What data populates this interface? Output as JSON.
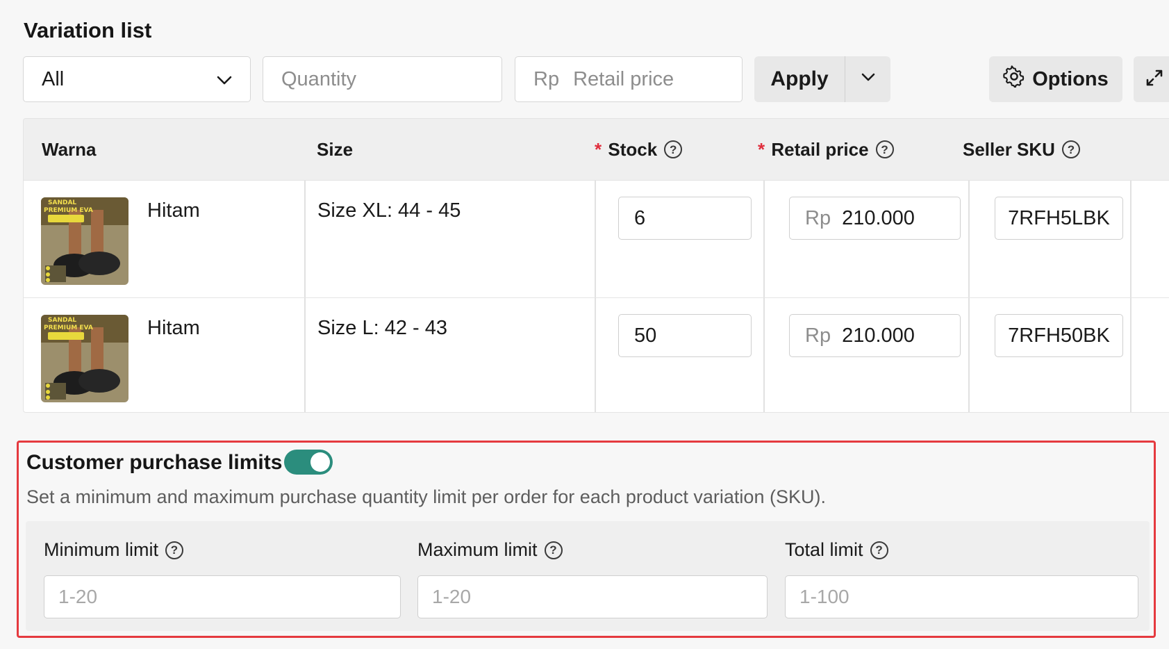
{
  "section": {
    "title": "Variation list"
  },
  "toolbar": {
    "filter_value": "All",
    "quantity_placeholder": "Quantity",
    "price_prefix": "Rp",
    "price_placeholder": "Retail price",
    "apply_label": "Apply",
    "options_label": "Options"
  },
  "table": {
    "headers": {
      "warna": "Warna",
      "size": "Size",
      "stock": "Stock",
      "retail_price": "Retail price",
      "seller_sku": "Seller SKU",
      "required_mark": "*"
    },
    "rows": [
      {
        "warna": "Hitam",
        "size": "Size XL: 44 - 45",
        "stock": "6",
        "price_prefix": "Rp",
        "price": "210.000",
        "sku": "7RFH5LBK"
      },
      {
        "warna": "Hitam",
        "size": "Size L: 42 - 43",
        "stock": "50",
        "price_prefix": "Rp",
        "price": "210.000",
        "sku": "7RFH50BK"
      }
    ],
    "thumbnail_text": [
      "SANDAL",
      "PREMIUM EVA"
    ]
  },
  "limits": {
    "title": "Customer purchase limits",
    "toggle_on": true,
    "description": "Set a minimum and maximum purchase quantity limit per order for each product variation (SKU).",
    "fields": [
      {
        "label": "Minimum limit",
        "placeholder": "1-20"
      },
      {
        "label": "Maximum limit",
        "placeholder": "1-20"
      },
      {
        "label": "Total limit",
        "placeholder": "1-100"
      }
    ]
  },
  "colors": {
    "accent_toggle": "#2b8d7d",
    "highlight_border": "#e53a3f",
    "required": "#e02d3c"
  }
}
